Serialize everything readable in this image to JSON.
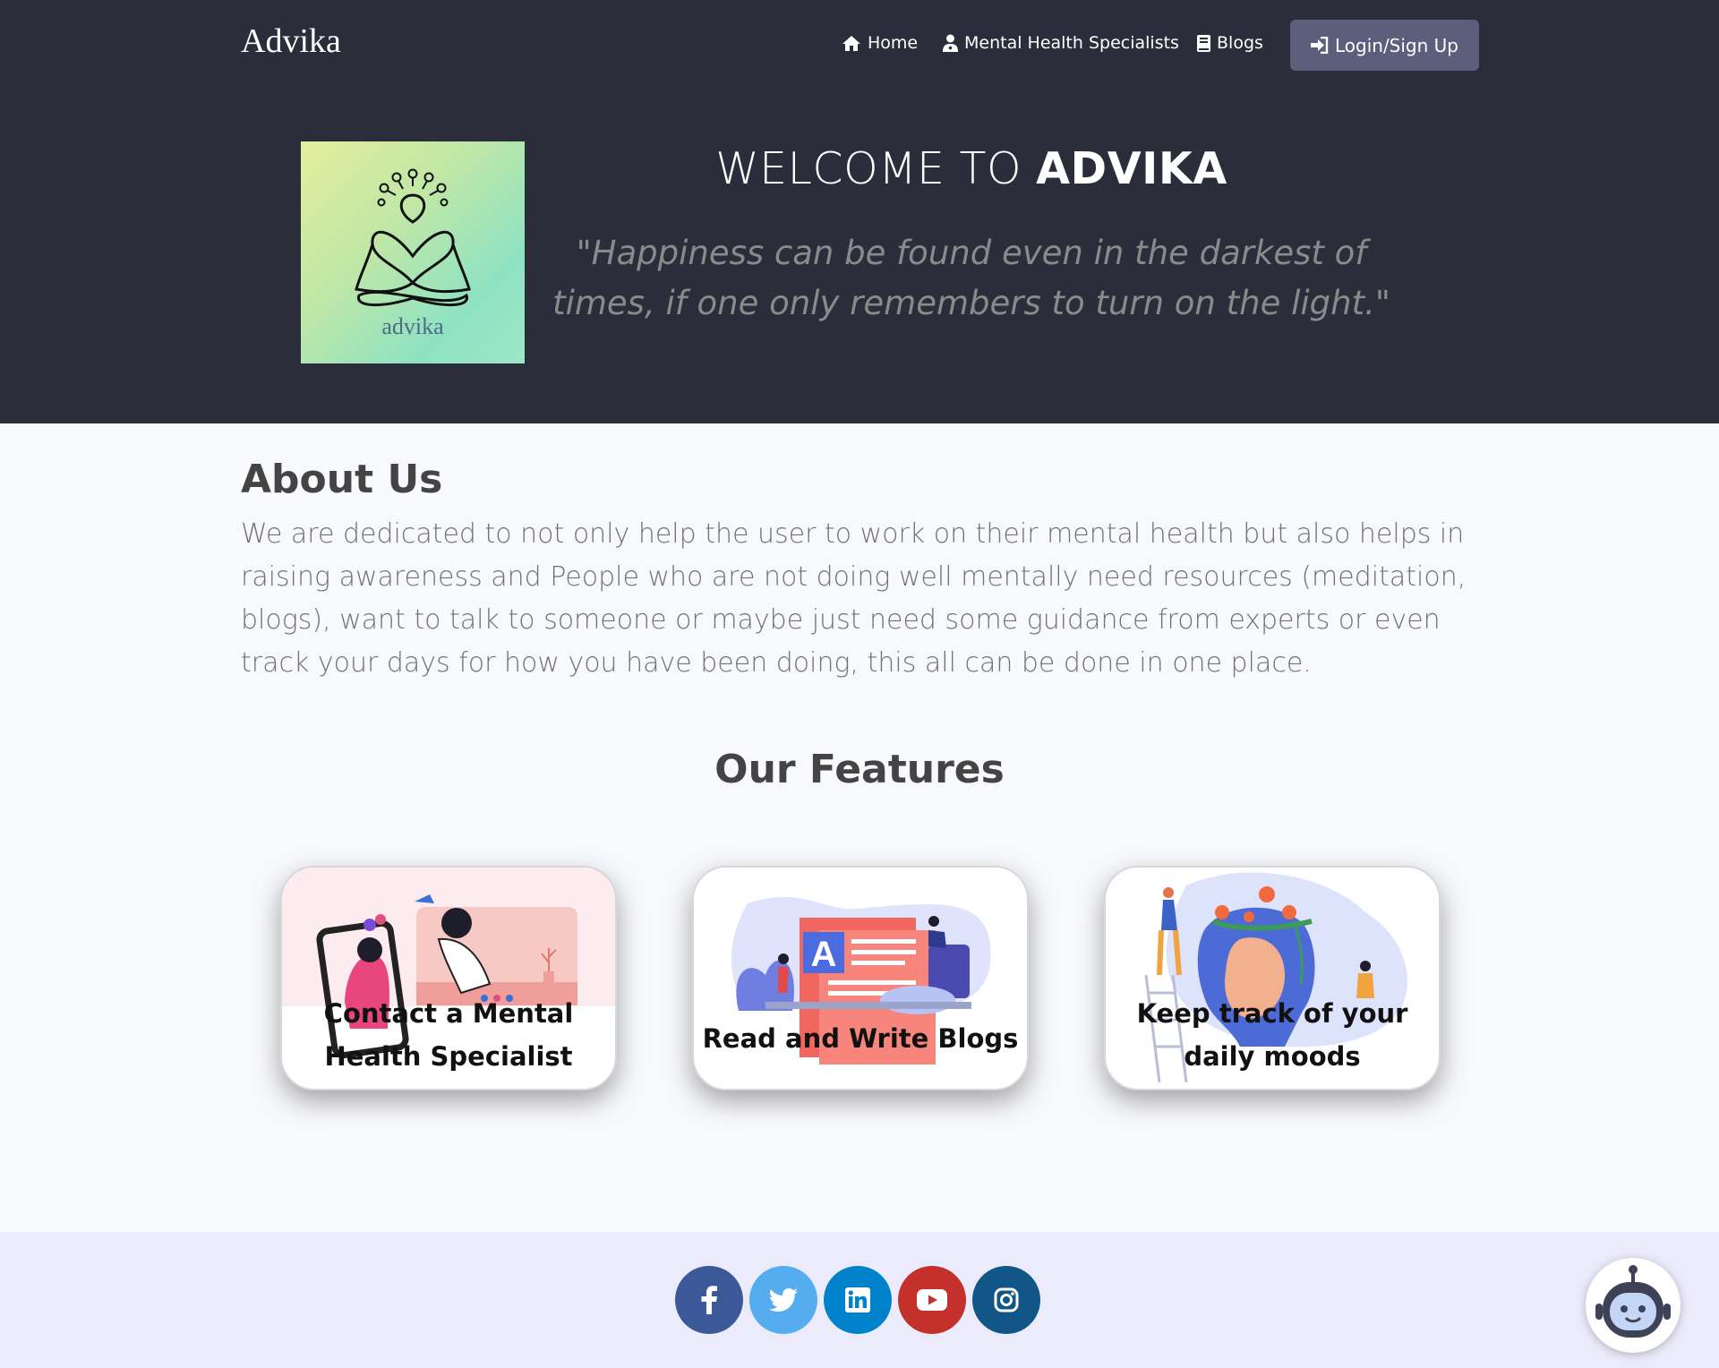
{
  "header": {
    "brand": "Advika",
    "nav": {
      "home": "Home",
      "specialists": "Mental Health Specialists",
      "blogs": "Blogs",
      "login": "Login/Sign Up"
    },
    "logo_text": "advika"
  },
  "hero": {
    "welcome_prefix": "WELCOME TO ",
    "welcome_brand": "ADVIKA",
    "quote": "\"Happiness can be found even in the darkest of times, if one only remembers to turn on the light.\""
  },
  "about": {
    "title": "About Us",
    "text": "We are dedicated to not only help the user to work on their mental health but also helps in raising awareness and People who are not doing well mentally need resources (meditation, blogs), want to talk to someone or maybe just need some guidance from experts or even track your days for how you have been doing, this all can be done in one place."
  },
  "features": {
    "title": "Our Features",
    "cards": [
      {
        "title": "Contact a Mental Health Specialist"
      },
      {
        "title": "Read and Write Blogs"
      },
      {
        "title": "Keep track of your daily moods"
      }
    ]
  },
  "footer": {
    "social_icons": [
      "facebook-icon",
      "twitter-icon",
      "linkedin-icon",
      "youtube-icon",
      "instagram-icon"
    ],
    "colors": {
      "facebook": "#3b5998",
      "twitter": "#55acee",
      "linkedin": "#0082ca",
      "youtube": "#c4302b",
      "instagram": "#125688"
    }
  },
  "colors": {
    "header_bg": "#2c2d3a",
    "login_button": "#5c5e7c",
    "page_bg": "#f8f9fc",
    "footer_bg": "#ecebfb"
  }
}
